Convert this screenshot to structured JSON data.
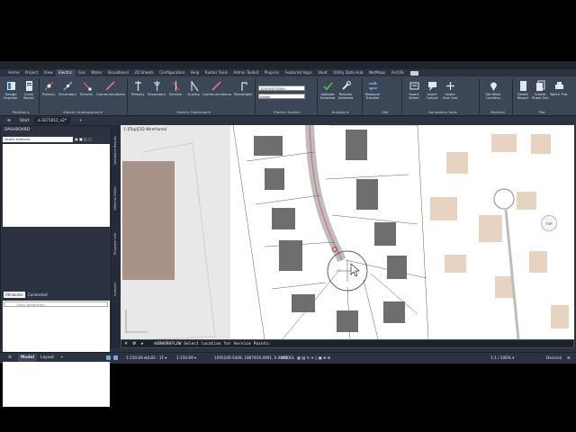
{
  "ribbon_tabs": [
    "Home",
    "Project",
    "View",
    "Electric",
    "Gas",
    "Water",
    "Broadband",
    "2D Sheets",
    "Configuration",
    "Help",
    "Raster Tools",
    "Admin Toolkit",
    "Plug-ins",
    "Featured Apps",
    "Vault",
    "Utility Data Hub",
    "NetMaps",
    "ArcGIS"
  ],
  "active_tab": "Electric",
  "ribbon": {
    "design_explorer": "Design\nExplorer",
    "clash_board": "Clash\nBoard",
    "palettes": "Palettes ▾",
    "ug_primary": "Primary",
    "ug_secondary": "Secondary",
    "ug_service": "Service",
    "ug_comms": "Communications",
    "electric_underground": "Electric Underground ▾",
    "oh_primary": "Primary",
    "oh_secondary": "Secondary",
    "oh_service": "Service",
    "oh_guying": "Guying",
    "oh_comms": "Communications",
    "oh_streetlight": "Streetlight",
    "electric_overhead": "Electric Overhead ▾",
    "voltage_combo": "12470Y/7200V",
    "phase_combo": "Install",
    "electric_system": "Electric System",
    "validate": "Validate\nSelected",
    "resolve": "Resolve\nSelected",
    "analysis": "Analysis ▾",
    "replace": "Replace/\nTransfer",
    "edit": "Edit",
    "insert_detail": "Insert\nDetail",
    "insert_callout": "Insert\nCallout",
    "insert_oneline": "Insert\nOne Line",
    "annotation_tools": "Annotation Tools",
    "set_work_location": "Set Work\nLocation",
    "material": "Material",
    "select_report": "Select\nReport",
    "create_sheet_set": "Create\nSheet Set",
    "batch_plot": "Batch Plot",
    "plot": "Plot"
  },
  "doc_tabs": {
    "start": "Start",
    "file": "a-3271012_v2*",
    "add": "+"
  },
  "dashboard": {
    "title": "DASHBOARD",
    "select_features": "Select features",
    "tab_attributes": "Attributes",
    "tab_connected": "Connected",
    "filter_placeholder": "Filter properties..."
  },
  "vtabs": [
    "Validation Results",
    "Material Editor",
    "Template Info",
    "Analysis"
  ],
  "canvas": {
    "view_label": "[-][Top][2D Wireframe]",
    "viewcube": "TOP"
  },
  "command": {
    "prompt": "AUDWORKFLOW Select location for Service Points:"
  },
  "status": {
    "model": "Model",
    "layout": "Layout",
    "add": "+",
    "coords": "1095209.5408, 1867919.4991, 0.0000",
    "model_label": "MODEL",
    "scale": "1:150.69 ▾",
    "layer": "UL83 - 1F ▾",
    "zoom": "1:1 / 100% ▾",
    "units": "Decimal"
  },
  "colors": {
    "accent": "#2e7d32",
    "canvas_bg": "#ffffff",
    "panel": "#3b4656"
  }
}
